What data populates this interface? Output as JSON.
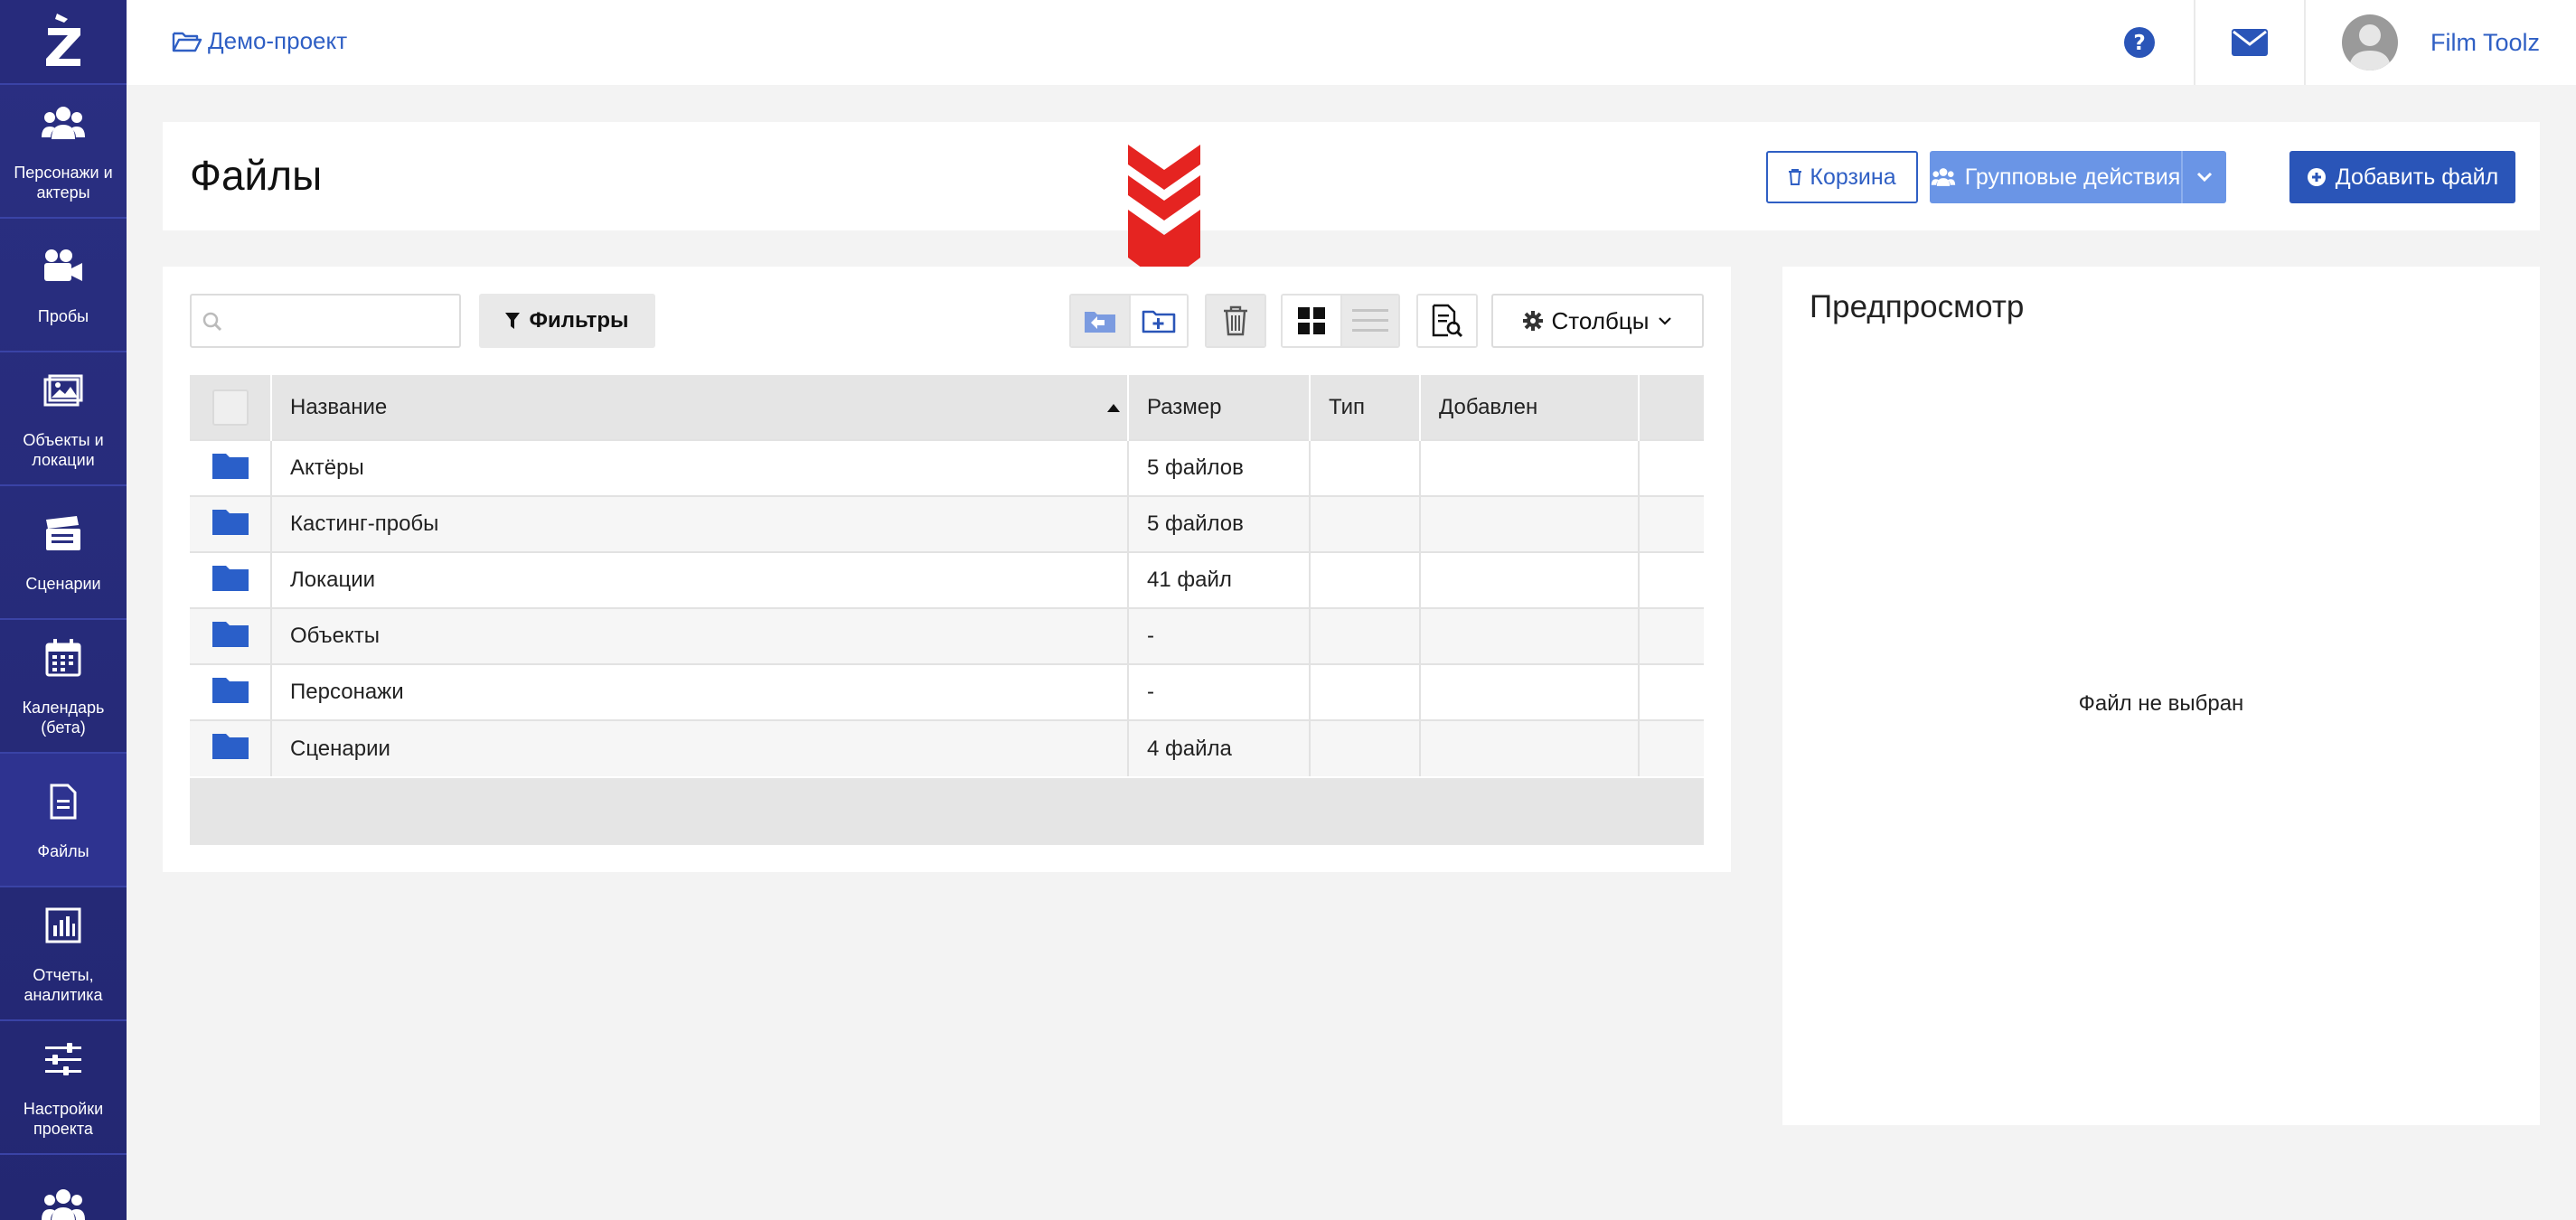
{
  "sidebar": {
    "items": [
      {
        "label": "Персонажи и актеры",
        "icon": "users-icon"
      },
      {
        "label": "Пробы",
        "icon": "video-camera-icon"
      },
      {
        "label": "Объекты и локации",
        "icon": "image-icon"
      },
      {
        "label": "Сценарии",
        "icon": "clapperboard-icon"
      },
      {
        "label": "Календарь (бета)",
        "icon": "calendar-icon"
      },
      {
        "label": "Файлы",
        "icon": "file-icon"
      },
      {
        "label": "Отчеты, аналитика",
        "icon": "bar-chart-icon"
      },
      {
        "label": "Настройки проекта",
        "icon": "sliders-icon"
      },
      {
        "label": "",
        "icon": "users-icon"
      }
    ]
  },
  "topbar": {
    "project": "Демо-проект",
    "user_name": "Film Toolz"
  },
  "header": {
    "title": "Файлы",
    "trash_label": "Корзина",
    "group_actions_label": "Групповые действия",
    "add_file_label": "Добавить файл"
  },
  "toolbar": {
    "search_placeholder": "",
    "filters_label": "Фильтры",
    "columns_label": "Столбцы"
  },
  "table": {
    "columns": [
      "Название",
      "Размер",
      "Тип",
      "Добавлен"
    ],
    "sorted_column": "Название",
    "rows": [
      {
        "name": "Актёры",
        "size": "5 файлов",
        "type": "",
        "added": ""
      },
      {
        "name": "Кастинг-пробы",
        "size": "5 файлов",
        "type": "",
        "added": ""
      },
      {
        "name": "Локации",
        "size": "41 файл",
        "type": "",
        "added": ""
      },
      {
        "name": "Объекты",
        "size": "-",
        "type": "",
        "added": ""
      },
      {
        "name": "Персонажи",
        "size": "-",
        "type": "",
        "added": ""
      },
      {
        "name": "Сценарии",
        "size": "4 файла",
        "type": "",
        "added": ""
      }
    ]
  },
  "preview": {
    "title": "Предпросмотр",
    "empty_text": "Файл не выбран"
  },
  "colors": {
    "sidebar": "#2a2f82",
    "accent": "#2a55b8",
    "link": "#2f5fc4",
    "folder": "#2a5fc9",
    "arrow": "#e52421"
  }
}
